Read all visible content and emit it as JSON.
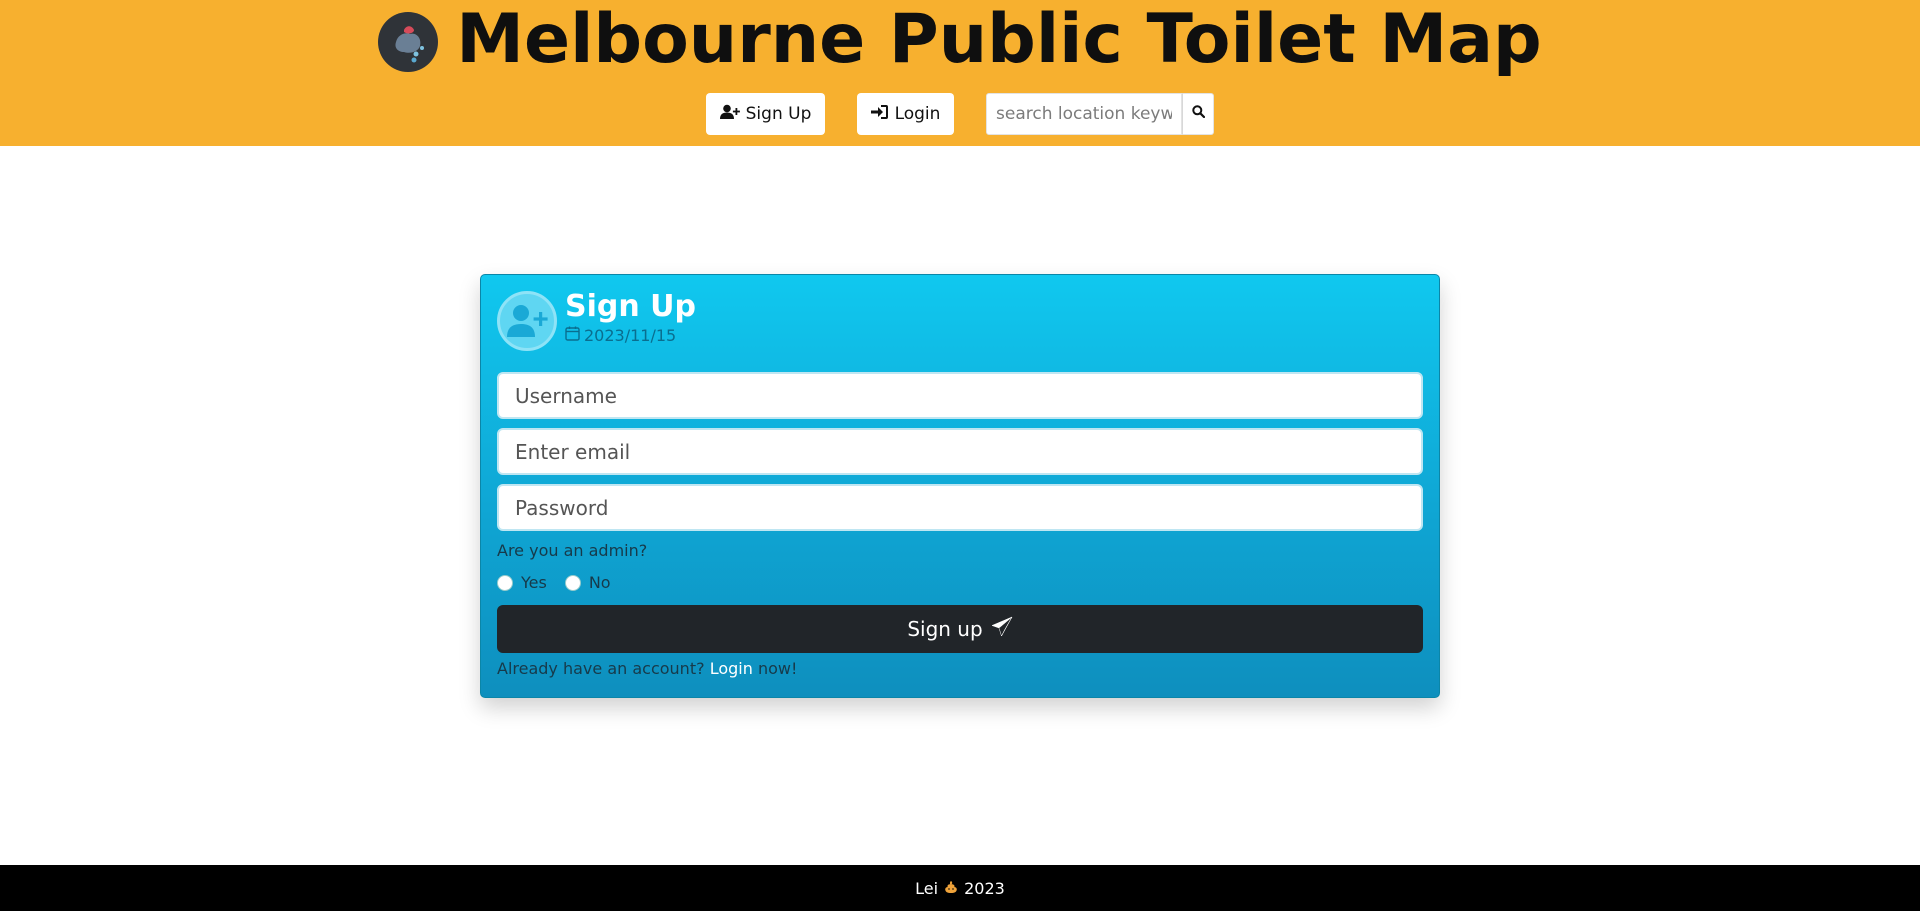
{
  "header": {
    "title": "Melbourne Public Toilet Map",
    "signup_label": "Sign Up",
    "login_label": "Login",
    "search_placeholder": "search location keywords",
    "background_color": "#f7b02f"
  },
  "card": {
    "title": "Sign Up",
    "date": "2023/11/15",
    "username_placeholder": "Username",
    "email_placeholder": "Enter email",
    "password_placeholder": "Password",
    "admin_question": "Are you an admin?",
    "radio_yes": "Yes",
    "radio_no": "No",
    "submit_label": "Sign up",
    "login_prompt_prefix": "Already have an account?",
    "login_link": "Login",
    "login_prompt_suffix": "now!",
    "accent_color": "#10c8ef"
  },
  "footer": {
    "author": "Lei",
    "icon": "poop-icon",
    "year": "2023"
  }
}
